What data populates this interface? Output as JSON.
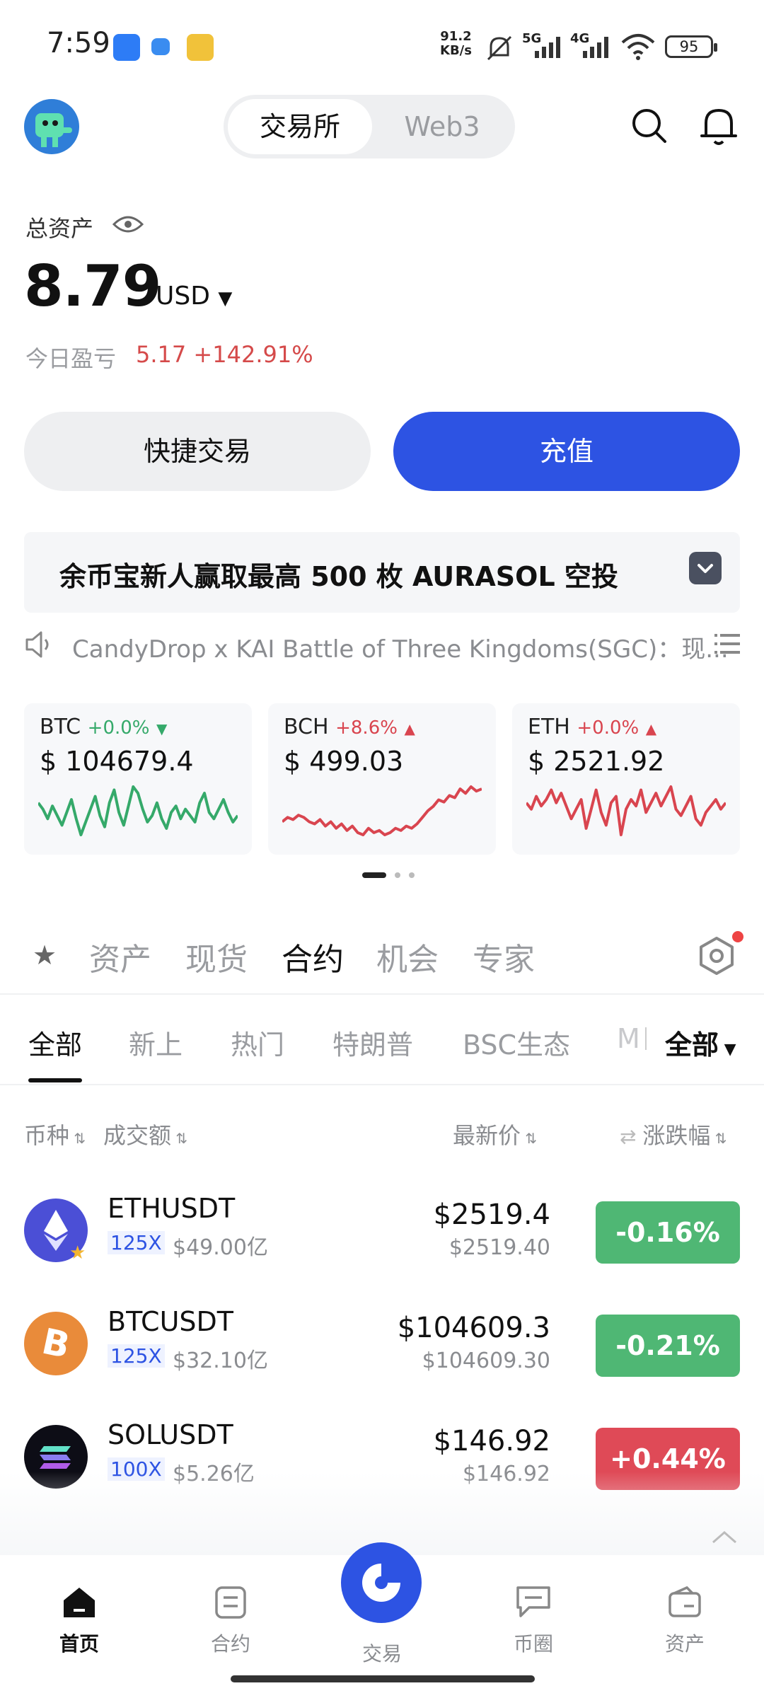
{
  "status_bar": {
    "time": "7:59",
    "speed_value": "91.2",
    "speed_unit": "KB/s",
    "net1": "5G",
    "net2": "4G",
    "battery": "95"
  },
  "header": {
    "tabs": [
      {
        "label": "交易所",
        "active": true
      },
      {
        "label": "Web3",
        "active": false
      }
    ]
  },
  "assets": {
    "label": "总资产",
    "amount": "8.79",
    "currency": "USD",
    "pnl_label": "今日盈亏",
    "pnl_value": "5.17 +142.91%"
  },
  "actions": {
    "quick_trade": "快捷交易",
    "deposit": "充值"
  },
  "promo": {
    "text": "余币宝新人赢取最高 500 枚 AURASOL 空投"
  },
  "notice": {
    "text": "CandyDrop x KAI Battle of Three Kingdoms(SGC)：现..."
  },
  "tickers": [
    {
      "symbol": "BTC",
      "change": "+0.0%",
      "direction": "down",
      "color": "#35a96a",
      "price": "$ 104679.4",
      "spark": [
        50,
        46,
        40,
        48,
        42,
        36,
        44,
        52,
        40,
        30,
        38,
        46,
        54,
        42,
        35,
        50,
        58,
        44,
        36,
        48,
        60,
        56,
        46,
        38,
        42,
        50,
        40,
        34,
        44,
        48,
        40,
        46,
        42,
        38,
        50,
        56,
        44,
        40,
        46,
        52,
        44,
        38,
        42
      ]
    },
    {
      "symbol": "BCH",
      "change": "+8.6%",
      "direction": "up",
      "color": "#d9454f",
      "price": "$ 499.03",
      "spark": [
        40,
        44,
        42,
        46,
        44,
        40,
        38,
        42,
        36,
        40,
        34,
        38,
        32,
        36,
        30,
        28,
        34,
        30,
        32,
        28,
        30,
        34,
        32,
        36,
        34,
        38,
        44,
        50,
        54,
        60,
        58,
        64,
        62,
        70,
        66,
        72,
        68,
        70
      ]
    },
    {
      "symbol": "ETH",
      "change": "+0.0%",
      "direction": "up",
      "color": "#d9454f",
      "price": "$ 2521.92",
      "spark": [
        50,
        46,
        54,
        48,
        52,
        58,
        50,
        56,
        48,
        40,
        46,
        52,
        34,
        46,
        58,
        44,
        36,
        50,
        54,
        30,
        46,
        52,
        48,
        58,
        44,
        50,
        56,
        48,
        54,
        60,
        46,
        42,
        48,
        54,
        40,
        36,
        44,
        48,
        52,
        46,
        50
      ]
    }
  ],
  "categories": [
    {
      "label": "资产",
      "active": false
    },
    {
      "label": "现货",
      "active": false
    },
    {
      "label": "合约",
      "active": true
    },
    {
      "label": "机会",
      "active": false
    },
    {
      "label": "专家",
      "active": false
    }
  ],
  "subtabs": [
    {
      "label": "全部",
      "active": true
    },
    {
      "label": "新上",
      "active": false
    },
    {
      "label": "热门",
      "active": false
    },
    {
      "label": "特朗普",
      "active": false
    },
    {
      "label": "BSC生态",
      "active": false
    },
    {
      "label": "M",
      "active": false
    }
  ],
  "subtab_filter": "全部",
  "columns": {
    "coin": "币种",
    "volume": "成交额",
    "last_price": "最新价",
    "change": "涨跌幅"
  },
  "markets": [
    {
      "pair": "ETHUSDT",
      "leverage": "125X",
      "volume": "$49.00亿",
      "price": "$2519.4",
      "price_sub": "$2519.40",
      "change": "-0.16%",
      "change_color": "#4fb774",
      "coin_color": "#4b4fd6"
    },
    {
      "pair": "BTCUSDT",
      "leverage": "125X",
      "volume": "$32.10亿",
      "price": "$104609.3",
      "price_sub": "$104609.30",
      "change": "-0.21%",
      "change_color": "#4fb774",
      "coin_color": "#e98b3a"
    },
    {
      "pair": "SOLUSDT",
      "leverage": "100X",
      "volume": "$5.26亿",
      "price": "$146.92",
      "price_sub": "$146.92",
      "change": "+0.44%",
      "change_color": "#df4a57",
      "coin_color": "#0d0d16"
    }
  ],
  "bottom_nav": [
    {
      "label": "首页",
      "active": true
    },
    {
      "label": "合约",
      "active": false
    },
    {
      "label": "交易",
      "active": false
    },
    {
      "label": "币圈",
      "active": false
    },
    {
      "label": "资产",
      "active": false
    }
  ]
}
